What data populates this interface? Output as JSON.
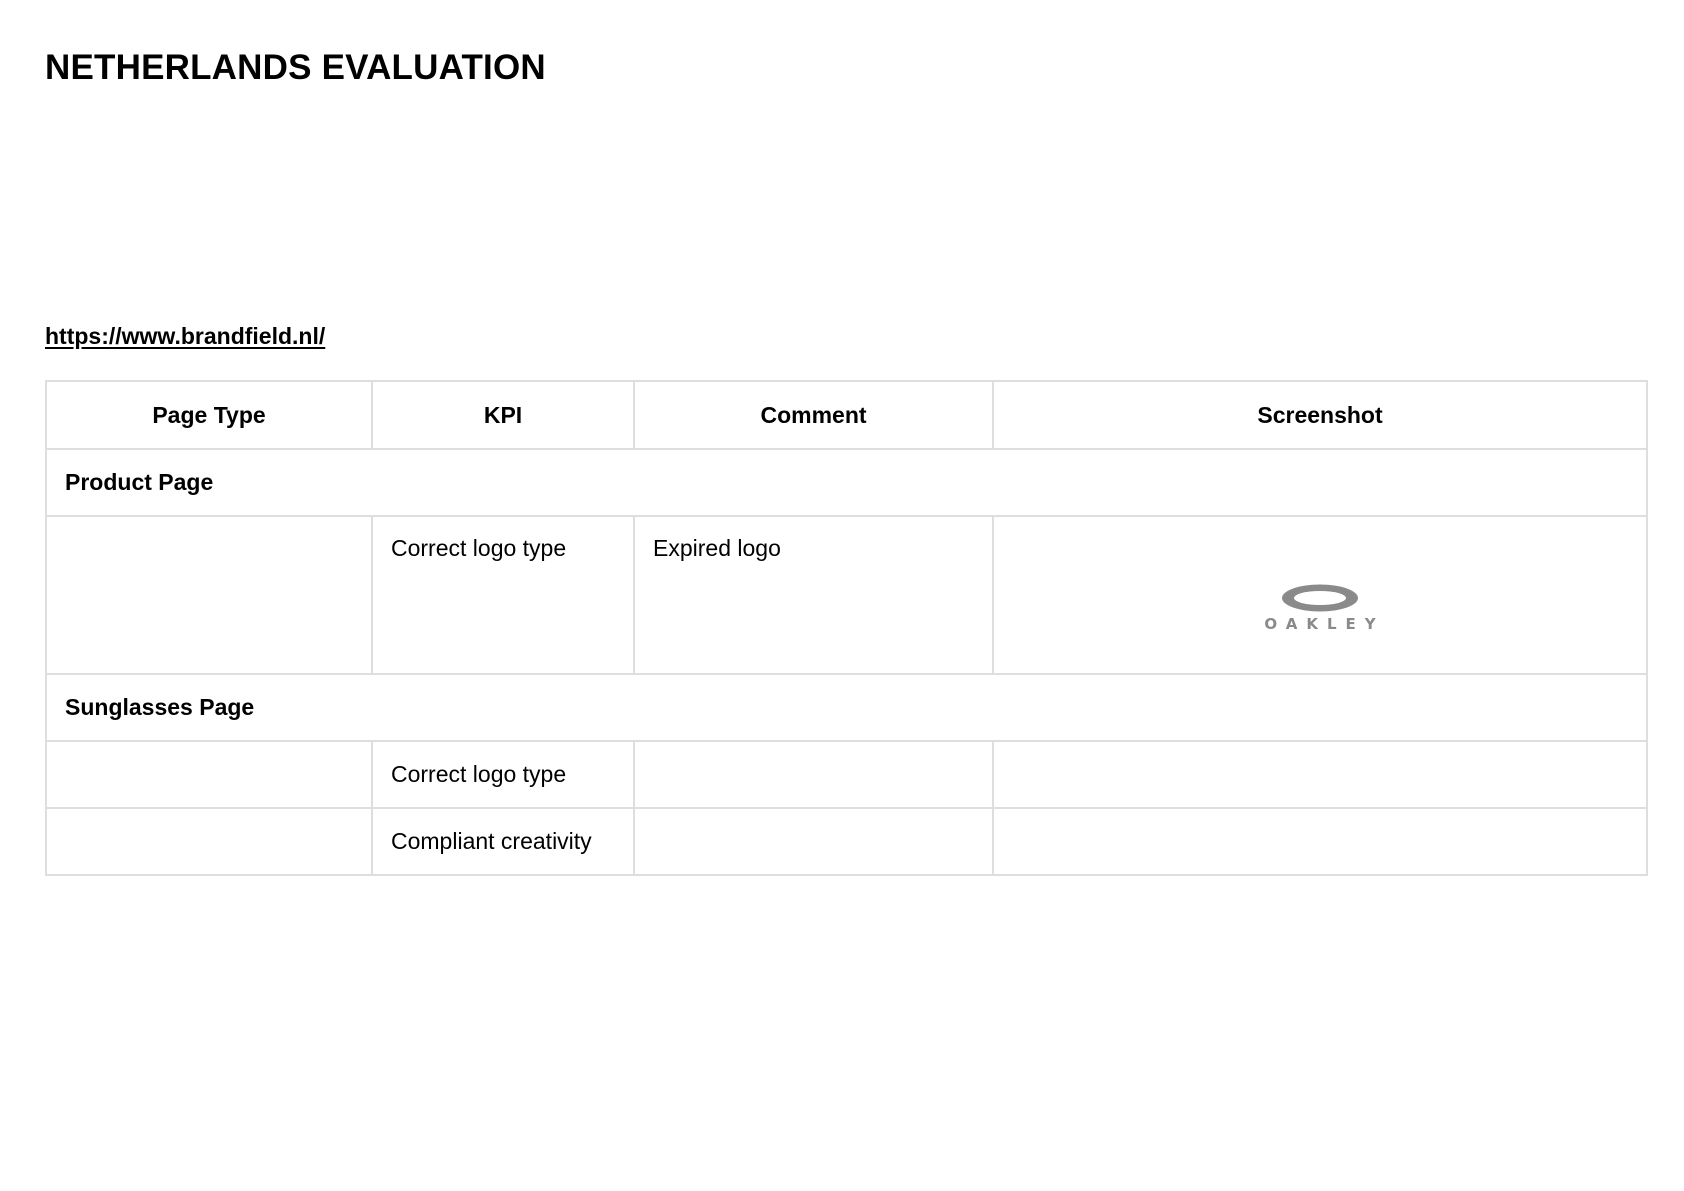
{
  "document": {
    "title": "NETHERLANDS EVALUATION",
    "url": "https://www.brandfield.nl/"
  },
  "table": {
    "headers": {
      "page_type": "Page Type",
      "kpi": "KPI",
      "comment": "Comment",
      "screenshot": "Screenshot"
    },
    "sections": [
      {
        "label": "Product Page",
        "rows": [
          {
            "page_type": "",
            "kpi": "Correct logo type",
            "comment": "Expired logo",
            "screenshot_logo_text": "OAKLEY",
            "screenshot_logo_color": "#8a8a8a"
          }
        ]
      },
      {
        "label": "Sunglasses Page",
        "rows": [
          {
            "page_type": "",
            "kpi": "Correct logo type",
            "comment": ""
          },
          {
            "page_type": "",
            "kpi": "Compliant creativity",
            "comment": ""
          }
        ]
      }
    ]
  },
  "colors": {
    "border": "#dedede",
    "text": "#000000"
  }
}
